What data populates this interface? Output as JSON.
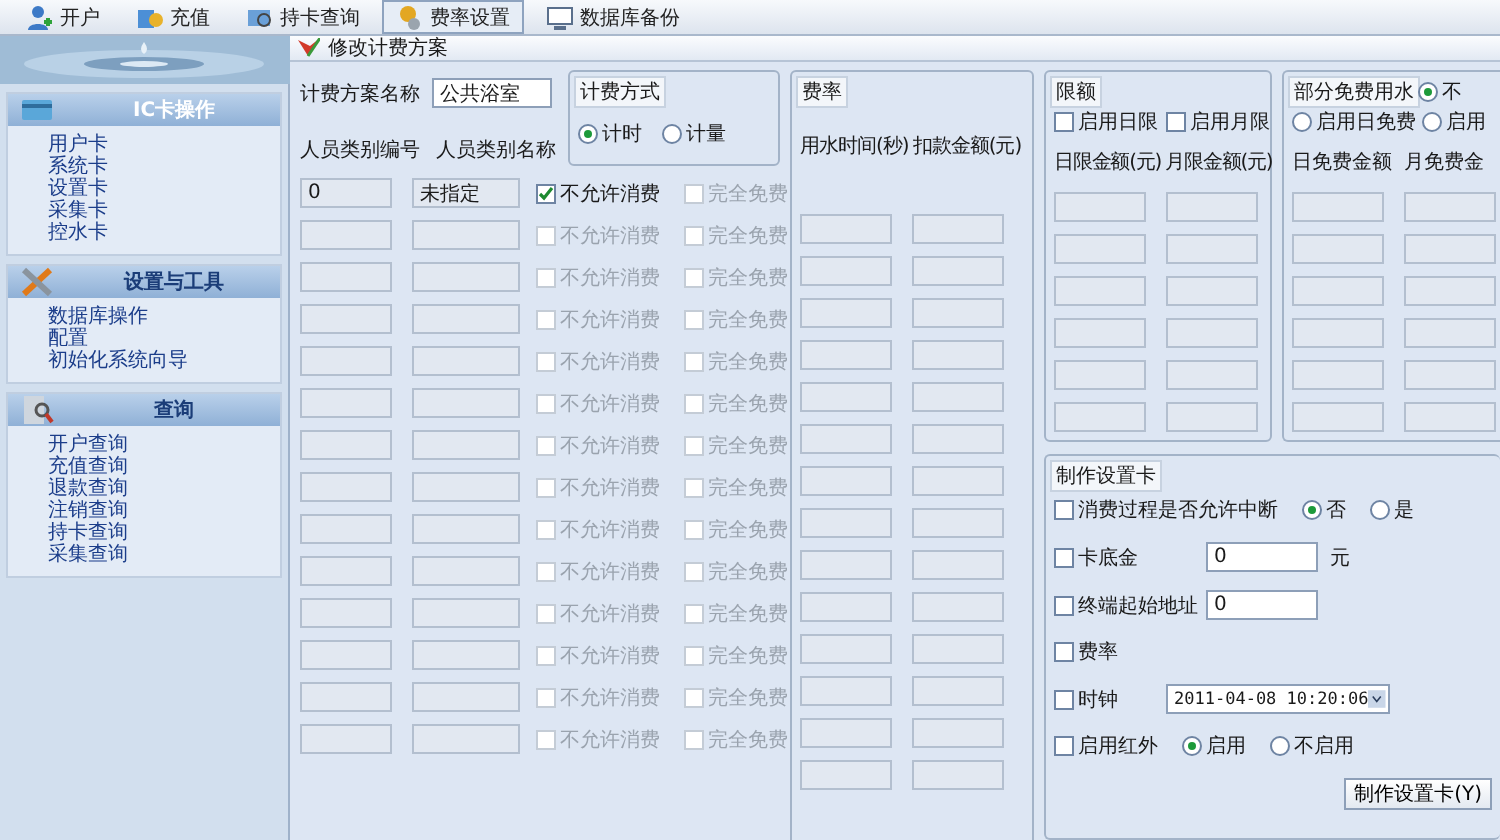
{
  "toolbar": [
    {
      "label": "开户",
      "kind": "user-add",
      "selected": false
    },
    {
      "label": "充值",
      "kind": "coins",
      "selected": false
    },
    {
      "label": "持卡查询",
      "kind": "card-search",
      "selected": false
    },
    {
      "label": "费率设置",
      "kind": "coin-gear",
      "selected": true
    },
    {
      "label": "数据库备份",
      "kind": "monitor",
      "selected": false
    }
  ],
  "sidebar": {
    "sections": [
      {
        "title": "IC卡操作",
        "kind": "card",
        "items": [
          "用户卡",
          "系统卡",
          "设置卡",
          "采集卡",
          "控水卡"
        ]
      },
      {
        "title": "设置与工具",
        "kind": "tools",
        "items": [
          "数据库操作",
          "配置",
          "初始化系统向导"
        ]
      },
      {
        "title": "查询",
        "kind": "search",
        "items": [
          "开户查询",
          "充值查询",
          "退款查询",
          "注销查询",
          "持卡查询",
          "采集查询"
        ]
      }
    ]
  },
  "dialog": {
    "title": "修改计费方案",
    "plan_name": {
      "label": "计费方案名称",
      "value": "公共浴室"
    },
    "billing_mode": {
      "title": "计费方式",
      "options": [
        {
          "label": "计时",
          "selected": true
        },
        {
          "label": "计量",
          "selected": false
        }
      ]
    },
    "categories": {
      "columns": [
        "人员类别编号",
        "人员类别名称"
      ],
      "rows": [
        {
          "id": "0",
          "name": "未指定",
          "disabled": false,
          "no_consume": {
            "label": "不允许消费",
            "checked": true
          },
          "full_free": {
            "label": "完全免费",
            "checked": false
          }
        },
        {
          "disabled": true,
          "no_consume": {
            "label": "不允许消费",
            "checked": false
          },
          "full_free": {
            "label": "完全免费",
            "checked": false
          }
        },
        {
          "disabled": true,
          "no_consume": {
            "label": "不允许消费",
            "checked": false
          },
          "full_free": {
            "label": "完全免费",
            "checked": false
          }
        },
        {
          "disabled": true,
          "no_consume": {
            "label": "不允许消费",
            "checked": false
          },
          "full_free": {
            "label": "完全免费",
            "checked": false
          }
        },
        {
          "disabled": true,
          "no_consume": {
            "label": "不允许消费",
            "checked": false
          },
          "full_free": {
            "label": "完全免费",
            "checked": false
          }
        },
        {
          "disabled": true,
          "no_consume": {
            "label": "不允许消费",
            "checked": false
          },
          "full_free": {
            "label": "完全免费",
            "checked": false
          }
        },
        {
          "disabled": true,
          "no_consume": {
            "label": "不允许消费",
            "checked": false
          },
          "full_free": {
            "label": "完全免费",
            "checked": false
          }
        },
        {
          "disabled": true,
          "no_consume": {
            "label": "不允许消费",
            "checked": false
          },
          "full_free": {
            "label": "完全免费",
            "checked": false
          }
        },
        {
          "disabled": true,
          "no_consume": {
            "label": "不允许消费",
            "checked": false
          },
          "full_free": {
            "label": "完全免费",
            "checked": false
          }
        },
        {
          "disabled": true,
          "no_consume": {
            "label": "不允许消费",
            "checked": false
          },
          "full_free": {
            "label": "完全免费",
            "checked": false
          }
        },
        {
          "disabled": true,
          "no_consume": {
            "label": "不允许消费",
            "checked": false
          },
          "full_free": {
            "label": "完全免费",
            "checked": false
          }
        },
        {
          "disabled": true,
          "no_consume": {
            "label": "不允许消费",
            "checked": false
          },
          "full_free": {
            "label": "完全免费",
            "checked": false
          }
        },
        {
          "disabled": true,
          "no_consume": {
            "label": "不允许消费",
            "checked": false
          },
          "full_free": {
            "label": "完全免费",
            "checked": false
          }
        },
        {
          "disabled": true,
          "no_consume": {
            "label": "不允许消费",
            "checked": false
          },
          "full_free": {
            "label": "完全免费",
            "checked": false
          }
        }
      ]
    },
    "rate": {
      "title": "费率",
      "columns": [
        "用水时间(秒)",
        "扣款金额(元)"
      ],
      "rows": [
        {
          "disabled": true
        },
        {
          "disabled": true
        },
        {
          "disabled": true
        },
        {
          "disabled": true
        },
        {
          "disabled": true
        },
        {
          "disabled": true
        },
        {
          "disabled": true
        },
        {
          "disabled": true
        },
        {
          "disabled": true
        },
        {
          "disabled": true
        },
        {
          "disabled": true
        },
        {
          "disabled": true
        },
        {
          "disabled": true
        },
        {
          "disabled": true
        }
      ]
    },
    "limit": {
      "title": "限额",
      "checks": [
        {
          "label": "启用日限",
          "checked": false
        },
        {
          "label": "启用月限",
          "checked": false
        }
      ],
      "columns": [
        "日限金额(元)",
        "月限金额(元)"
      ],
      "rows": [
        {
          "disabled": true
        },
        {
          "disabled": true
        },
        {
          "disabled": true
        },
        {
          "disabled": true
        },
        {
          "disabled": true
        },
        {
          "disabled": true
        }
      ]
    },
    "partial_free": {
      "title": "部分免费用水",
      "options": [
        {
          "label": "不",
          "selected": true
        },
        {
          "label": "启用日免费",
          "selected": false
        },
        {
          "label": "启用",
          "selected": false
        }
      ],
      "columns": [
        "日免费金额",
        "月免费金"
      ],
      "rows": [
        {
          "disabled": true
        },
        {
          "disabled": true
        },
        {
          "disabled": true
        },
        {
          "disabled": true
        },
        {
          "disabled": true
        },
        {
          "disabled": true
        }
      ]
    },
    "make_card": {
      "title": "制作设置卡",
      "rows": [
        {
          "kind": "radio",
          "label": "消费过程是否允许中断",
          "checked": false,
          "options": [
            {
              "label": "否",
              "selected": true
            },
            {
              "label": "是",
              "selected": false
            }
          ]
        },
        {
          "kind": "field",
          "label": "卡底金",
          "checked": false,
          "value": "0",
          "unit": "元"
        },
        {
          "kind": "field",
          "label": "终端起始地址",
          "checked": false,
          "value": "0"
        },
        {
          "kind": "plain",
          "label": "费率",
          "checked": false
        },
        {
          "kind": "dropdown",
          "label": "时钟",
          "checked": false,
          "value": "2011-04-08 10:20:06"
        },
        {
          "kind": "radio",
          "label": "启用红外",
          "checked": false,
          "options": [
            {
              "label": "启用",
              "selected": true
            },
            {
              "label": "不启用",
              "selected": false
            }
          ]
        }
      ],
      "button": "制作设置卡(Y)"
    }
  }
}
